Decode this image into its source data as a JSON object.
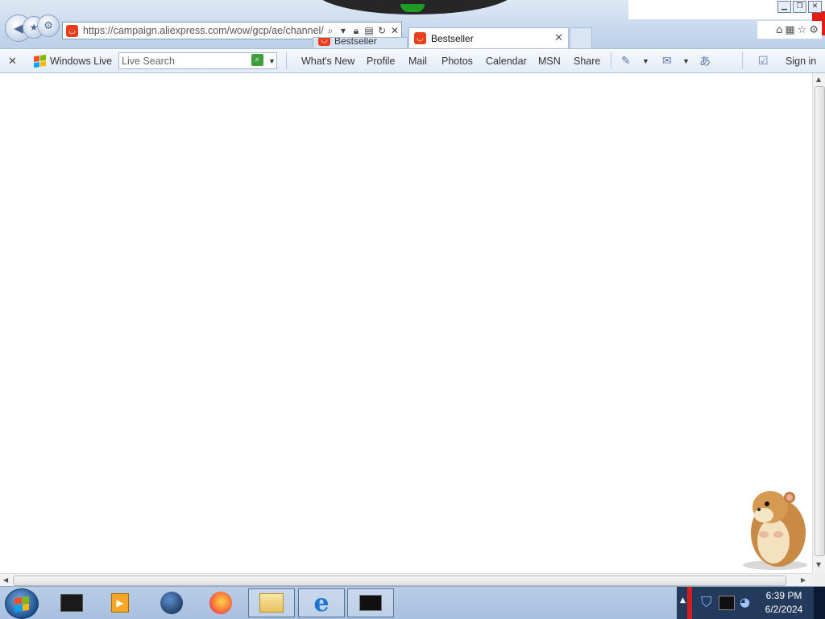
{
  "browser": {
    "address_url": "https://campaign.aliexpress.com/wow/gcp/ae/channel/",
    "tabs": [
      {
        "label": "Bestseller",
        "active": false
      },
      {
        "label": "Bestseller",
        "active": true
      }
    ],
    "tab_close_glyph": "✕"
  },
  "toolbar": {
    "brand": "Windows Live",
    "search_placeholder": "Live Search",
    "links": [
      "What's New",
      "Profile",
      "Mail",
      "Photos",
      "Calendar",
      "MSN",
      "Share"
    ],
    "sign_in": "Sign in"
  },
  "taskbar": {
    "clock_time": "6:39 PM",
    "clock_date": "6/2/2024"
  },
  "colors": {
    "aliexpress_red": "#e8401c",
    "search_green": "#3fa03a",
    "chrome_blue": "#c9d9ee"
  },
  "icons": [
    "back-icon",
    "forward-icon",
    "gear-icon",
    "search-icon",
    "lock-icon",
    "refresh-icon",
    "close-icon",
    "home-icon",
    "feeds-icon",
    "print-icon",
    "tools-icon",
    "highlighter-icon",
    "mail-icon",
    "translate-icon",
    "checkbox-icon",
    "windows-logo-icon",
    "hamster-icon"
  ]
}
